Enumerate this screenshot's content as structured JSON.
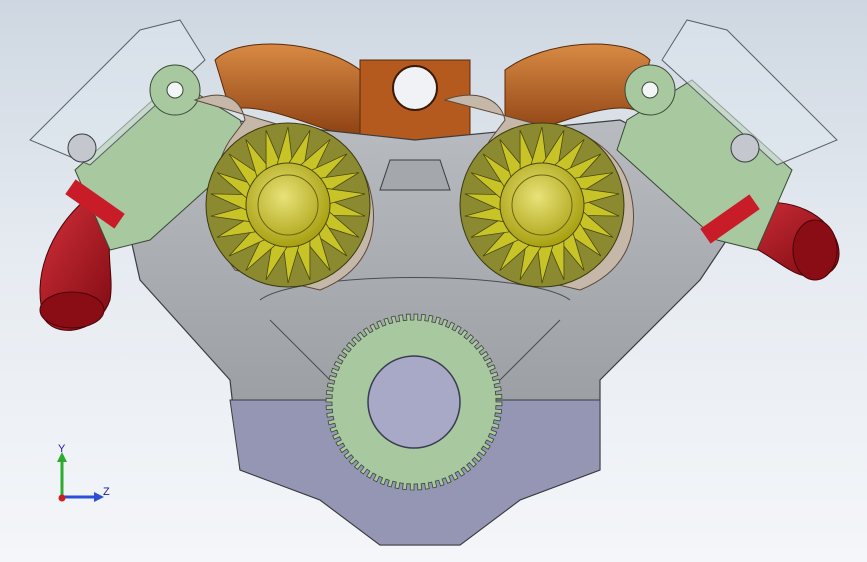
{
  "viewport": {
    "background_top": "#ced7e1",
    "background_bottom": "#f4f6f9"
  },
  "model": {
    "block_color": "#9a9da2",
    "head_color": "#a8c8a0",
    "gear_color": "#a8c8a0",
    "turbo_wheel_color": "#c8c428",
    "housing_color": "#c6b8a8",
    "intake_color": "#b45a1e",
    "exhaust_color": "#a8101a",
    "crank_bore_color": "#a7a9c6"
  },
  "triad": {
    "y_label": "Y",
    "z_label": "Z",
    "y_color": "#2eaa2e",
    "z_color": "#2b4fd6",
    "x_color": "#cc1f1f"
  }
}
